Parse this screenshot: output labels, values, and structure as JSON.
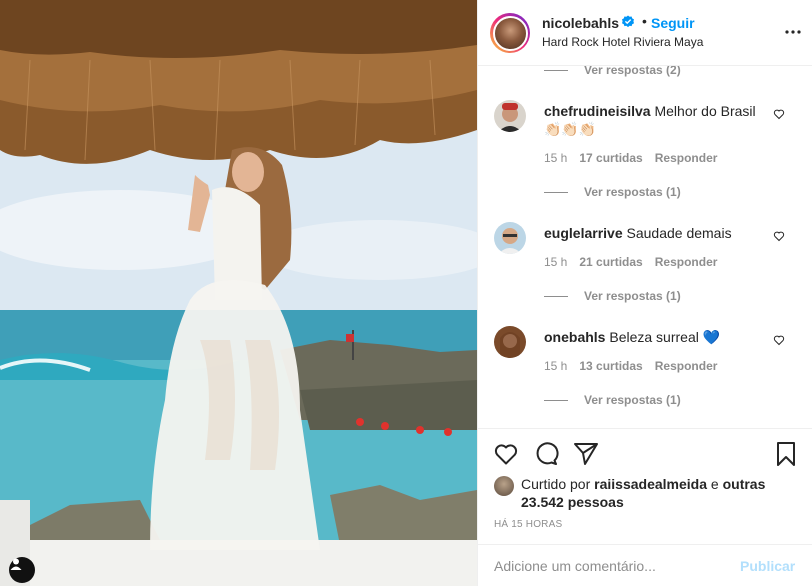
{
  "post": {
    "username": "nicolebahls",
    "dot": "•",
    "follow_label": "Seguir",
    "location": "Hard Rock Hotel Riviera Maya"
  },
  "comments": {
    "top_view_replies": "Ver respostas (2)",
    "items": [
      {
        "username": "chefrudineisilva",
        "text": "Melhor do Brasil 👏🏻👏🏻👏🏻",
        "time": "15 h",
        "likes": "17 curtidas",
        "reply": "Responder",
        "view_replies": "Ver respostas (1)"
      },
      {
        "username": "euglelarrive",
        "text": "Saudade demais",
        "time": "15 h",
        "likes": "21 curtidas",
        "reply": "Responder",
        "view_replies": "Ver respostas (1)"
      },
      {
        "username": "onebahls",
        "text": "Beleza surreal 💙",
        "time": "15 h",
        "likes": "13 curtidas",
        "reply": "Responder",
        "view_replies": "Ver respostas (1)"
      }
    ]
  },
  "likes": {
    "prefix": "Curtido por",
    "user": "raiissadealmeida",
    "conj": "e",
    "others": "outras 23.542 pessoas"
  },
  "timestamp": "HÁ 15 HORAS",
  "composer": {
    "placeholder": "Adicione um comentário...",
    "publish_label": "Publicar"
  },
  "icons": {
    "like": "heart-icon",
    "comment": "comment-icon",
    "share": "share-icon",
    "save": "bookmark-icon",
    "verified": "verified-badge-icon",
    "more": "more-options-icon"
  },
  "colors": {
    "link_blue": "#0095f6",
    "publish_disabled": "#b2dffc",
    "muted": "#8e8e8e",
    "border": "#efefef"
  }
}
